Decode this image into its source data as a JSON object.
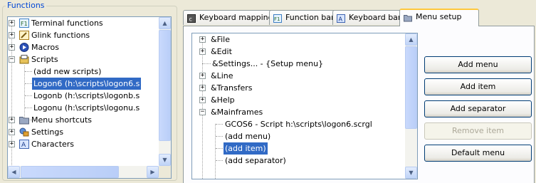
{
  "functions_panel": {
    "title": "Functions",
    "tree": [
      {
        "label": "Terminal functions",
        "icon": "terminal-functions-icon",
        "expander": "+"
      },
      {
        "label": "Glink functions",
        "icon": "glink-functions-icon",
        "expander": "+"
      },
      {
        "label": "Macros",
        "icon": "macros-icon",
        "expander": "+"
      },
      {
        "label": "Scripts",
        "icon": "scripts-icon",
        "expander": "−"
      },
      {
        "label": "(add new scripts)"
      },
      {
        "label": "Logon6 (h:\\scripts\\logon6.s",
        "selected": true
      },
      {
        "label": "Logonb (h:\\scripts\\logonb.s"
      },
      {
        "label": "Logonu (h:\\scripts\\logonu.s"
      },
      {
        "label": "Menu shortcuts",
        "icon": "folder-icon",
        "expander": "+"
      },
      {
        "label": "Settings",
        "icon": "settings-icon",
        "expander": "+"
      },
      {
        "label": "Characters",
        "icon": "characters-icon",
        "expander": "+"
      }
    ]
  },
  "tabs": [
    {
      "label": "Keyboard mappings",
      "icon": "keyboard-mappings-icon",
      "active": false
    },
    {
      "label": "Function bar",
      "icon": "function-bar-icon",
      "active": false
    },
    {
      "label": "Keyboard bar",
      "icon": "keyboard-bar-icon",
      "active": false
    },
    {
      "label": "Menu setup",
      "icon": "menu-setup-icon",
      "active": true
    }
  ],
  "menu_tree": [
    {
      "label": "&File",
      "expander": "+"
    },
    {
      "label": "&Edit",
      "expander": "+"
    },
    {
      "label": "&Settings... - {Setup menu}"
    },
    {
      "label": "&Line",
      "expander": "+"
    },
    {
      "label": "&Transfers",
      "expander": "+"
    },
    {
      "label": "&Help",
      "expander": "+"
    },
    {
      "label": "&Mainframes",
      "expander": "−"
    },
    {
      "label": "GCOS6 - Script h:\\scripts\\logon6.scrgl"
    },
    {
      "label": "(add menu)"
    },
    {
      "label": "(add item)",
      "selected": true
    },
    {
      "label": "(add separator)"
    }
  ],
  "buttons": {
    "add_menu": "Add menu",
    "add_item": "Add item",
    "add_separator": "Add separator",
    "remove_item": "Remove item",
    "default_menu": "Default menu"
  },
  "colors": {
    "selection": "#316AC5",
    "window_bg": "#ECE9D8",
    "groupbox_title": "#0046D5",
    "active_tab_accent": "#FFC83C"
  }
}
